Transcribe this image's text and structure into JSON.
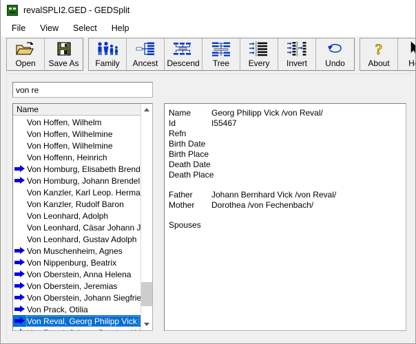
{
  "window": {
    "title": "revalSPLI2.GED - GEDSplit",
    "icon": "app-gedsplit-icon"
  },
  "menubar": {
    "items": [
      {
        "label": "File"
      },
      {
        "label": "View"
      },
      {
        "label": "Select"
      },
      {
        "label": "Help"
      }
    ]
  },
  "toolbar": {
    "groups": [
      {
        "buttons": [
          {
            "label": "Open",
            "icon": "open-folder-icon"
          },
          {
            "label": "Save As",
            "icon": "floppy-disk-icon"
          }
        ]
      },
      {
        "buttons": [
          {
            "label": "Family",
            "icon": "family-people-icon"
          },
          {
            "label": "Ancest",
            "icon": "ancestor-tree-icon"
          },
          {
            "label": "Descend",
            "icon": "descendant-tree-icon"
          },
          {
            "label": "Tree",
            "icon": "tree-chart-icon"
          },
          {
            "label": "Every",
            "icon": "select-every-icon"
          },
          {
            "label": "Invert",
            "icon": "invert-selection-icon"
          },
          {
            "label": "Undo",
            "icon": "undo-arrow-icon"
          }
        ]
      },
      {
        "buttons": [
          {
            "label": "About",
            "icon": "question-mark-icon"
          },
          {
            "label": "Help",
            "icon": "help-pointer-icon"
          }
        ]
      }
    ]
  },
  "search": {
    "value": "von re",
    "placeholder": ""
  },
  "list": {
    "header": "Name",
    "rows": [
      {
        "label": "Von Hoffen, Wilhelm",
        "marked": false,
        "selected": false
      },
      {
        "label": "Von Hoffen, Wilhelmine",
        "marked": false,
        "selected": false
      },
      {
        "label": "Von Hoffen, Wilhelmine",
        "marked": false,
        "selected": false
      },
      {
        "label": "Von Hoffenn, Heinrich",
        "marked": false,
        "selected": false
      },
      {
        "label": "Von Homburg, Elisabeth Brendel",
        "marked": true,
        "selected": false
      },
      {
        "label": "Von Homburg, Johann Brendel",
        "marked": true,
        "selected": false
      },
      {
        "label": "Von Kanzler, Karl Leop. Herman...",
        "marked": false,
        "selected": false
      },
      {
        "label": "Von Kanzler, Rudolf Baron",
        "marked": false,
        "selected": false
      },
      {
        "label": "Von Leonhard, Adolph",
        "marked": false,
        "selected": false
      },
      {
        "label": "Von Leonhard, Cäsar Johann Jo...",
        "marked": false,
        "selected": false
      },
      {
        "label": "Von Leonhard, Gustav Adolph",
        "marked": false,
        "selected": false
      },
      {
        "label": "Von Muschenheim, Agnes",
        "marked": true,
        "selected": false
      },
      {
        "label": "Von Nippenburg, Beatrix",
        "marked": true,
        "selected": false
      },
      {
        "label": "Von Oberstein, Anna Helena",
        "marked": true,
        "selected": false
      },
      {
        "label": "Von Oberstein, Jeremias",
        "marked": true,
        "selected": false
      },
      {
        "label": "Von Oberstein, Johann Siegfried",
        "marked": true,
        "selected": false
      },
      {
        "label": "Von Prack, Otilia",
        "marked": true,
        "selected": false
      },
      {
        "label": "Von Reval, Georg Philipp Vick",
        "marked": true,
        "selected": true
      },
      {
        "label": "Von Reval, Johann Bernhard Vick",
        "marked": true,
        "selected": false
      }
    ],
    "scrollbar": {
      "up_icon": "chevron-up-icon",
      "down_icon": "chevron-down-icon"
    }
  },
  "detail": {
    "fields": [
      {
        "key": "Name",
        "value": "Georg Philipp Vick /von Reval/"
      },
      {
        "key": "Id",
        "value": "I55467"
      },
      {
        "key": "Refn",
        "value": ""
      },
      {
        "key": "Birth Date",
        "value": ""
      },
      {
        "key": "Birth Place",
        "value": ""
      },
      {
        "key": "Death Date",
        "value": ""
      },
      {
        "key": "Death Place",
        "value": ""
      }
    ],
    "parents": [
      {
        "key": "Father",
        "value": "Johann Bernhard Vick /von Reval/"
      },
      {
        "key": "Mother",
        "value": "Dorothea /von Fechenbach/"
      }
    ],
    "spouses": [
      {
        "key": "Spouses",
        "value": ""
      }
    ]
  },
  "colors": {
    "selection_blue": "#0a6ed1",
    "marker_blue": "#0000e8",
    "window_face": "#f0f0f0",
    "icon_blue": "#0033cc",
    "icon_yellow": "#ffd700"
  }
}
